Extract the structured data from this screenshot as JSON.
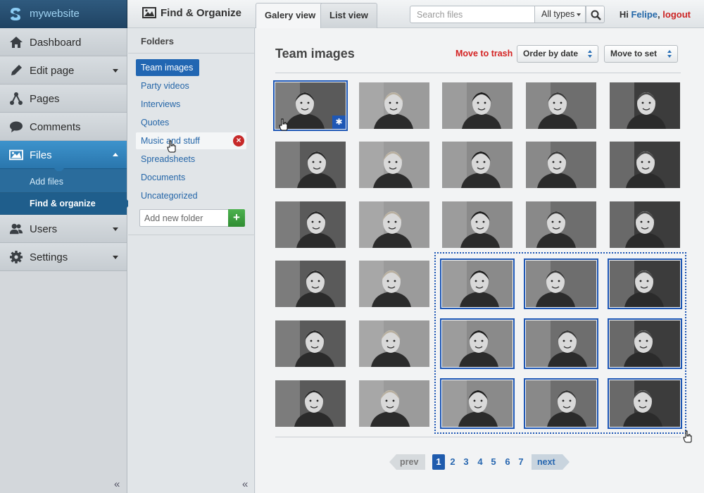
{
  "app": {
    "name": "mywebsite",
    "section_title": "Find & Organize"
  },
  "tabs": [
    {
      "label": "Galery view",
      "active": true
    },
    {
      "label": "List view",
      "active": false
    }
  ],
  "search": {
    "placeholder": "Search files",
    "type_filter": "All types"
  },
  "user": {
    "greeting": "Hi",
    "name": "Felipe",
    "logout": "logout"
  },
  "sidebar": {
    "items": [
      {
        "label": "Dashboard",
        "icon": "home-icon"
      },
      {
        "label": "Edit page",
        "icon": "pencil-icon",
        "has_menu": true
      },
      {
        "label": "Pages",
        "icon": "sitemap-icon"
      },
      {
        "label": "Comments",
        "icon": "speech-bubble-icon"
      },
      {
        "label": "Files",
        "icon": "image-icon",
        "has_menu": true,
        "active": true
      },
      {
        "label": "Users",
        "icon": "users-icon",
        "has_menu": true
      },
      {
        "label": "Settings",
        "icon": "gear-icon",
        "has_menu": true
      }
    ],
    "files_submenu": [
      {
        "label": "Add files"
      },
      {
        "label": "Find & organize",
        "current": true
      }
    ]
  },
  "folders": {
    "heading": "Folders",
    "items": [
      {
        "label": "Team images",
        "selected": true
      },
      {
        "label": "Party videos"
      },
      {
        "label": "Interviews"
      },
      {
        "label": "Quotes"
      },
      {
        "label": "Music and stuff",
        "hovered": true
      },
      {
        "label": "Spreadsheets"
      },
      {
        "label": "Documents"
      },
      {
        "label": "Uncategorized"
      }
    ],
    "new_folder_placeholder": "Add new folder"
  },
  "main": {
    "title": "Team images",
    "move_to_trash": "Move to trash",
    "order_dropdown": "Order by date",
    "move_to_set_dropdown": "Move to set",
    "grid_rows": 6,
    "grid_cols": 5,
    "selected_thumbnails": [
      0,
      17,
      18,
      19,
      22,
      23,
      24,
      27,
      28,
      29
    ]
  },
  "pagination": {
    "prev": "prev",
    "next": "next",
    "pages": [
      "1",
      "2",
      "3",
      "4",
      "5",
      "6",
      "7"
    ],
    "current": "1"
  },
  "colors": {
    "accent_blue": "#2166b2",
    "trash_red": "#d42222",
    "add_green": "#3a9e3c",
    "sidebar_active": "#2a76ad"
  }
}
